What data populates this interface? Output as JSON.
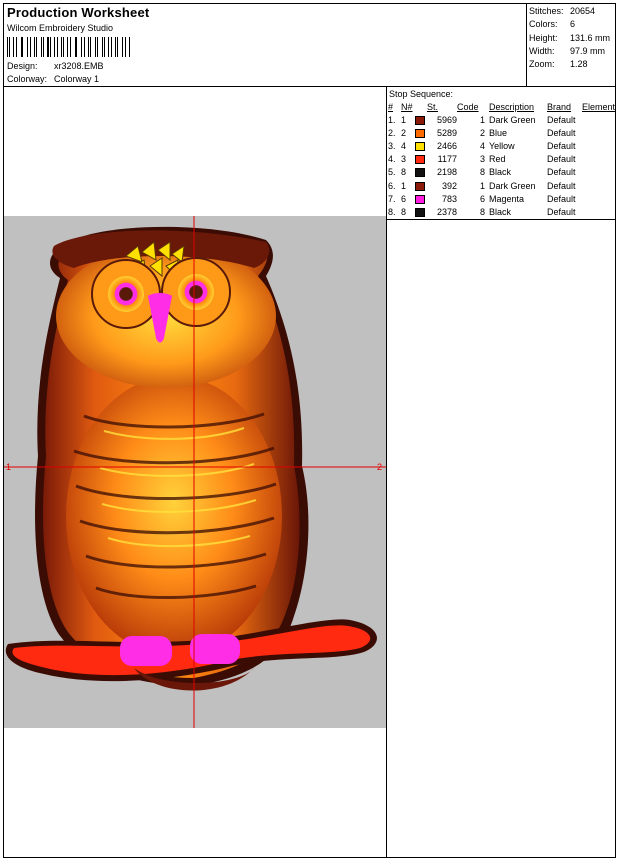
{
  "header": {
    "title": "Production Worksheet",
    "subtitle": "Wilcom  Embroidery Studio",
    "design_label": "Design:",
    "design_value": "xr3208.EMB",
    "colorway_label": "Colorway:",
    "colorway_value": "Colorway  1"
  },
  "stats": [
    {
      "label": "Stitches:",
      "value": "20654"
    },
    {
      "label": "Colors:",
      "value": "6"
    },
    {
      "label": "Height:",
      "value": "131.6 mm"
    },
    {
      "label": "Width:",
      "value": "97.9 mm"
    },
    {
      "label": "Zoom:",
      "value": "1.28"
    }
  ],
  "stop_sequence": {
    "title": "Stop Sequence:",
    "headers": [
      "#",
      "N#",
      "St.",
      "Code",
      "Description",
      "Brand",
      "Element"
    ],
    "rows": [
      {
        "idx": "1.",
        "n": "1",
        "color": "#8b1a0a",
        "st": "5969",
        "code": "1",
        "desc": "Dark Green",
        "brand": "Default"
      },
      {
        "idx": "2.",
        "n": "2",
        "color": "#ff6a00",
        "st": "5289",
        "code": "2",
        "desc": "Blue",
        "brand": "Default"
      },
      {
        "idx": "3.",
        "n": "4",
        "color": "#ffe000",
        "st": "2466",
        "code": "4",
        "desc": "Yellow",
        "brand": "Default"
      },
      {
        "idx": "4.",
        "n": "3",
        "color": "#ff2a10",
        "st": "1177",
        "code": "3",
        "desc": "Red",
        "brand": "Default"
      },
      {
        "idx": "5.",
        "n": "8",
        "color": "#111111",
        "st": "2198",
        "code": "8",
        "desc": "Black",
        "brand": "Default"
      },
      {
        "idx": "6.",
        "n": "1",
        "color": "#8b1a0a",
        "st": "392",
        "code": "1",
        "desc": "Dark Green",
        "brand": "Default"
      },
      {
        "idx": "7.",
        "n": "6",
        "color": "#ff1de0",
        "st": "783",
        "code": "6",
        "desc": "Magenta",
        "brand": "Default"
      },
      {
        "idx": "8.",
        "n": "8",
        "color": "#111111",
        "st": "2378",
        "code": "8",
        "desc": "Black",
        "brand": "Default"
      }
    ]
  },
  "canvas": {
    "background": "#c0c0c0",
    "axis_color": "#e00000",
    "marker_left": "1",
    "marker_right": "2"
  }
}
